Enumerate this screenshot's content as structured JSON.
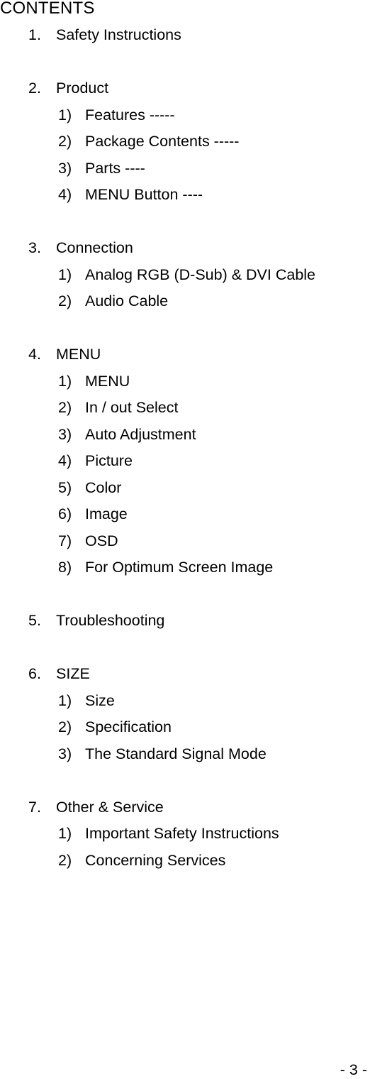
{
  "title": "CONTENTS",
  "sections": [
    {
      "num": "1.",
      "label": "Safety Instructions",
      "items": []
    },
    {
      "num": "2.",
      "label": "Product",
      "items": [
        {
          "num": "1)",
          "label": "Features -----"
        },
        {
          "num": "2)",
          "label": "Package Contents -----"
        },
        {
          "num": "3)",
          "label": "Parts ----"
        },
        {
          "num": "4)",
          "label": "MENU Button ----"
        }
      ]
    },
    {
      "num": "3.",
      "label": "Connection",
      "items": [
        {
          "num": "1)",
          "label": "Analog RGB (D-Sub) & DVI Cable"
        },
        {
          "num": "2)",
          "label": "Audio Cable"
        }
      ]
    },
    {
      "num": "4.",
      "label": "MENU",
      "items": [
        {
          "num": "1)",
          "label": "MENU"
        },
        {
          "num": "2)",
          "label": "In / out Select"
        },
        {
          "num": "3)",
          "label": "Auto Adjustment"
        },
        {
          "num": "4)",
          "label": "Picture"
        },
        {
          "num": "5)",
          "label": "Color"
        },
        {
          "num": "6)",
          "label": "Image"
        },
        {
          "num": "7)",
          "label": "OSD"
        },
        {
          "num": "8)",
          "label": "For Optimum Screen Image"
        }
      ]
    },
    {
      "num": "5.",
      "label": "Troubleshooting",
      "items": []
    },
    {
      "num": "6.",
      "label": "SIZE",
      "items": [
        {
          "num": "1)",
          "label": "Size"
        },
        {
          "num": "2)",
          "label": "Specification"
        },
        {
          "num": "3)",
          "label": "The Standard Signal Mode"
        }
      ]
    },
    {
      "num": "7.",
      "label": "Other & Service",
      "items": [
        {
          "num": "1)",
          "label": "Important Safety Instructions"
        },
        {
          "num": "2)",
          "label": "Concerning Services"
        }
      ]
    }
  ],
  "page_number": "- 3 -"
}
